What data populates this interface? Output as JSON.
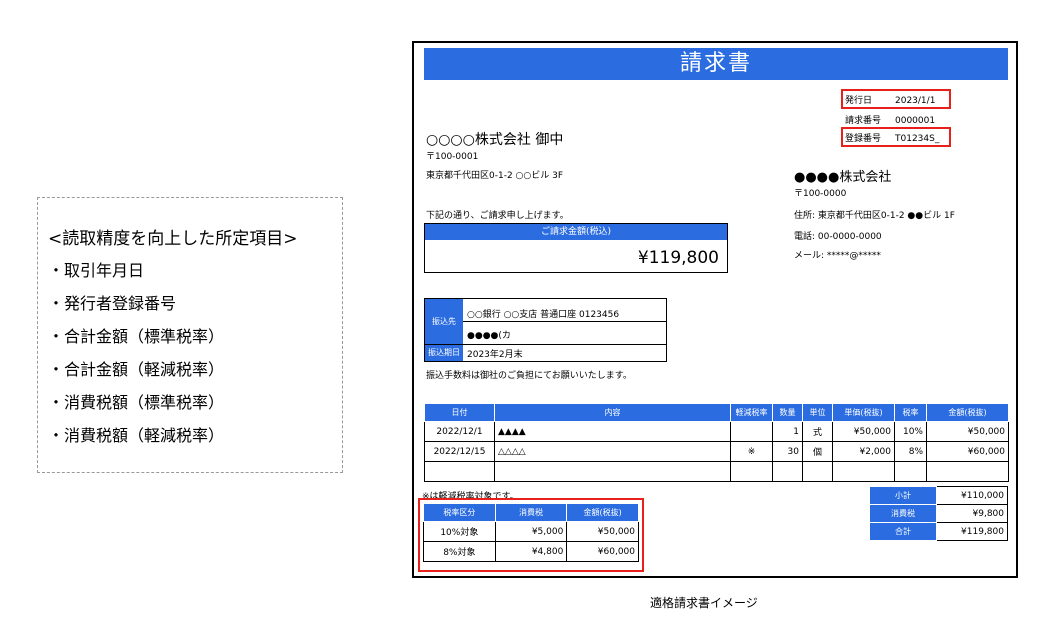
{
  "note": {
    "title": "<読取精度を向上した所定項目>",
    "items": [
      "・取引年月日",
      "・発行者登録番号",
      "・合計金額（標準税率）",
      "・合計金額（軽減税率）",
      "・消費税額（標準税率）",
      "・消費税額（軽減税率）"
    ]
  },
  "invoice": {
    "title": "請求書",
    "issue_date_label": "発行日",
    "issue_date": "2023/1/1",
    "invoice_no_label": "請求番号",
    "invoice_no": "0000001",
    "reg_no_label": "登録番号",
    "reg_no": "T01234S_",
    "recipient": "○○○○株式会社 御中",
    "recipient_zip": "〒100-0001",
    "recipient_addr": "東京都千代田区0-1-2 ○○ビル 3F",
    "intro": "下記の通り、ご請求申し上げます。",
    "total_label": "ご請求金額(税込)",
    "total": "¥119,800",
    "sender_name": "●●●●株式会社",
    "sender_zip": "〒100-0000",
    "sender_addr": "住所:  東京都千代田区0-1-2 ●●ビル 1F",
    "sender_tel": "電話:  00-0000-0000",
    "sender_mail": "メール:  *****@*****",
    "bank_label": "振込先",
    "bank_line1": "○○銀行 ○○支店 普通口座 0123456",
    "bank_line2": "●●●●(カ",
    "due_label": "振込期日",
    "due": "2023年2月末",
    "fee_note": "振込手数料は御社のご負担にてお願いいたします。",
    "items_headers": [
      "日付",
      "内容",
      "軽減税率",
      "数量",
      "単位",
      "単価(税抜)",
      "税率",
      "金額(税抜)"
    ],
    "items": [
      [
        "2022/12/1",
        "▲▲▲▲",
        "",
        "1",
        "式",
        "¥50,000",
        "10%",
        "¥50,000"
      ],
      [
        "2022/12/15",
        "△△△△",
        "※",
        "30",
        "個",
        "¥2,000",
        "8%",
        "¥60,000"
      ],
      [
        "",
        "",
        "",
        "",
        "",
        "",
        "",
        ""
      ]
    ],
    "reduced_note": "※は軽減税率対象です。",
    "summary": [
      {
        "label": "小計",
        "value": "¥110,000"
      },
      {
        "label": "消費税",
        "value": "¥9,800"
      },
      {
        "label": "合計",
        "value": "¥119,800"
      }
    ],
    "tax_headers": [
      "税率区分",
      "消費税",
      "金額(税抜)"
    ],
    "tax_rows": [
      [
        "10%対象",
        "¥5,000",
        "¥50,000"
      ],
      [
        "8%対象",
        "¥4,800",
        "¥60,000"
      ]
    ]
  },
  "caption": "適格請求書イメージ",
  "colors": {
    "header_blue": "#2b6de0",
    "highlight_red": "#e8201b"
  }
}
